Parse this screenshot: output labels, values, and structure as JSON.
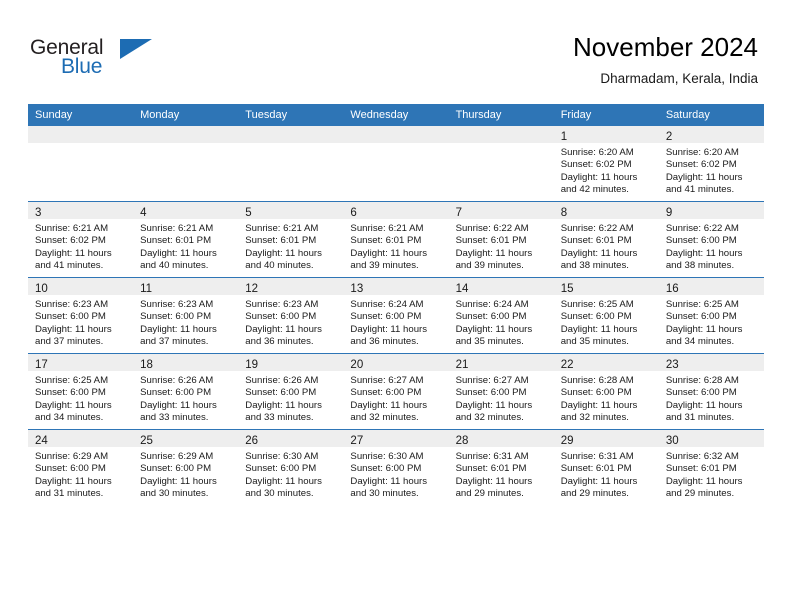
{
  "brand": {
    "logo_line1": "General",
    "logo_line2": "Blue",
    "logo_icon": "blue-triangle-icon",
    "color_dark": "#231f20",
    "color_blue": "#1d6cb3"
  },
  "header": {
    "title": "November 2024",
    "subtitle": "Dharmadam, Kerala, India"
  },
  "theme": {
    "header_bg": "#2e75b6",
    "header_text": "#ffffff",
    "daynum_band_bg": "#eeeeee",
    "cell_bg": "#ffffff",
    "row_separator": "#2e75b6"
  },
  "weekday_headers": [
    "Sunday",
    "Monday",
    "Tuesday",
    "Wednesday",
    "Thursday",
    "Friday",
    "Saturday"
  ],
  "weeks": [
    [
      {
        "day": "",
        "lines": []
      },
      {
        "day": "",
        "lines": []
      },
      {
        "day": "",
        "lines": []
      },
      {
        "day": "",
        "lines": []
      },
      {
        "day": "",
        "lines": []
      },
      {
        "day": "1",
        "lines": [
          "Sunrise: 6:20 AM",
          "Sunset: 6:02 PM",
          "Daylight: 11 hours",
          "and 42 minutes."
        ]
      },
      {
        "day": "2",
        "lines": [
          "Sunrise: 6:20 AM",
          "Sunset: 6:02 PM",
          "Daylight: 11 hours",
          "and 41 minutes."
        ]
      }
    ],
    [
      {
        "day": "3",
        "lines": [
          "Sunrise: 6:21 AM",
          "Sunset: 6:02 PM",
          "Daylight: 11 hours",
          "and 41 minutes."
        ]
      },
      {
        "day": "4",
        "lines": [
          "Sunrise: 6:21 AM",
          "Sunset: 6:01 PM",
          "Daylight: 11 hours",
          "and 40 minutes."
        ]
      },
      {
        "day": "5",
        "lines": [
          "Sunrise: 6:21 AM",
          "Sunset: 6:01 PM",
          "Daylight: 11 hours",
          "and 40 minutes."
        ]
      },
      {
        "day": "6",
        "lines": [
          "Sunrise: 6:21 AM",
          "Sunset: 6:01 PM",
          "Daylight: 11 hours",
          "and 39 minutes."
        ]
      },
      {
        "day": "7",
        "lines": [
          "Sunrise: 6:22 AM",
          "Sunset: 6:01 PM",
          "Daylight: 11 hours",
          "and 39 minutes."
        ]
      },
      {
        "day": "8",
        "lines": [
          "Sunrise: 6:22 AM",
          "Sunset: 6:01 PM",
          "Daylight: 11 hours",
          "and 38 minutes."
        ]
      },
      {
        "day": "9",
        "lines": [
          "Sunrise: 6:22 AM",
          "Sunset: 6:00 PM",
          "Daylight: 11 hours",
          "and 38 minutes."
        ]
      }
    ],
    [
      {
        "day": "10",
        "lines": [
          "Sunrise: 6:23 AM",
          "Sunset: 6:00 PM",
          "Daylight: 11 hours",
          "and 37 minutes."
        ]
      },
      {
        "day": "11",
        "lines": [
          "Sunrise: 6:23 AM",
          "Sunset: 6:00 PM",
          "Daylight: 11 hours",
          "and 37 minutes."
        ]
      },
      {
        "day": "12",
        "lines": [
          "Sunrise: 6:23 AM",
          "Sunset: 6:00 PM",
          "Daylight: 11 hours",
          "and 36 minutes."
        ]
      },
      {
        "day": "13",
        "lines": [
          "Sunrise: 6:24 AM",
          "Sunset: 6:00 PM",
          "Daylight: 11 hours",
          "and 36 minutes."
        ]
      },
      {
        "day": "14",
        "lines": [
          "Sunrise: 6:24 AM",
          "Sunset: 6:00 PM",
          "Daylight: 11 hours",
          "and 35 minutes."
        ]
      },
      {
        "day": "15",
        "lines": [
          "Sunrise: 6:25 AM",
          "Sunset: 6:00 PM",
          "Daylight: 11 hours",
          "and 35 minutes."
        ]
      },
      {
        "day": "16",
        "lines": [
          "Sunrise: 6:25 AM",
          "Sunset: 6:00 PM",
          "Daylight: 11 hours",
          "and 34 minutes."
        ]
      }
    ],
    [
      {
        "day": "17",
        "lines": [
          "Sunrise: 6:25 AM",
          "Sunset: 6:00 PM",
          "Daylight: 11 hours",
          "and 34 minutes."
        ]
      },
      {
        "day": "18",
        "lines": [
          "Sunrise: 6:26 AM",
          "Sunset: 6:00 PM",
          "Daylight: 11 hours",
          "and 33 minutes."
        ]
      },
      {
        "day": "19",
        "lines": [
          "Sunrise: 6:26 AM",
          "Sunset: 6:00 PM",
          "Daylight: 11 hours",
          "and 33 minutes."
        ]
      },
      {
        "day": "20",
        "lines": [
          "Sunrise: 6:27 AM",
          "Sunset: 6:00 PM",
          "Daylight: 11 hours",
          "and 32 minutes."
        ]
      },
      {
        "day": "21",
        "lines": [
          "Sunrise: 6:27 AM",
          "Sunset: 6:00 PM",
          "Daylight: 11 hours",
          "and 32 minutes."
        ]
      },
      {
        "day": "22",
        "lines": [
          "Sunrise: 6:28 AM",
          "Sunset: 6:00 PM",
          "Daylight: 11 hours",
          "and 32 minutes."
        ]
      },
      {
        "day": "23",
        "lines": [
          "Sunrise: 6:28 AM",
          "Sunset: 6:00 PM",
          "Daylight: 11 hours",
          "and 31 minutes."
        ]
      }
    ],
    [
      {
        "day": "24",
        "lines": [
          "Sunrise: 6:29 AM",
          "Sunset: 6:00 PM",
          "Daylight: 11 hours",
          "and 31 minutes."
        ]
      },
      {
        "day": "25",
        "lines": [
          "Sunrise: 6:29 AM",
          "Sunset: 6:00 PM",
          "Daylight: 11 hours",
          "and 30 minutes."
        ]
      },
      {
        "day": "26",
        "lines": [
          "Sunrise: 6:30 AM",
          "Sunset: 6:00 PM",
          "Daylight: 11 hours",
          "and 30 minutes."
        ]
      },
      {
        "day": "27",
        "lines": [
          "Sunrise: 6:30 AM",
          "Sunset: 6:00 PM",
          "Daylight: 11 hours",
          "and 30 minutes."
        ]
      },
      {
        "day": "28",
        "lines": [
          "Sunrise: 6:31 AM",
          "Sunset: 6:01 PM",
          "Daylight: 11 hours",
          "and 29 minutes."
        ]
      },
      {
        "day": "29",
        "lines": [
          "Sunrise: 6:31 AM",
          "Sunset: 6:01 PM",
          "Daylight: 11 hours",
          "and 29 minutes."
        ]
      },
      {
        "day": "30",
        "lines": [
          "Sunrise: 6:32 AM",
          "Sunset: 6:01 PM",
          "Daylight: 11 hours",
          "and 29 minutes."
        ]
      }
    ]
  ]
}
